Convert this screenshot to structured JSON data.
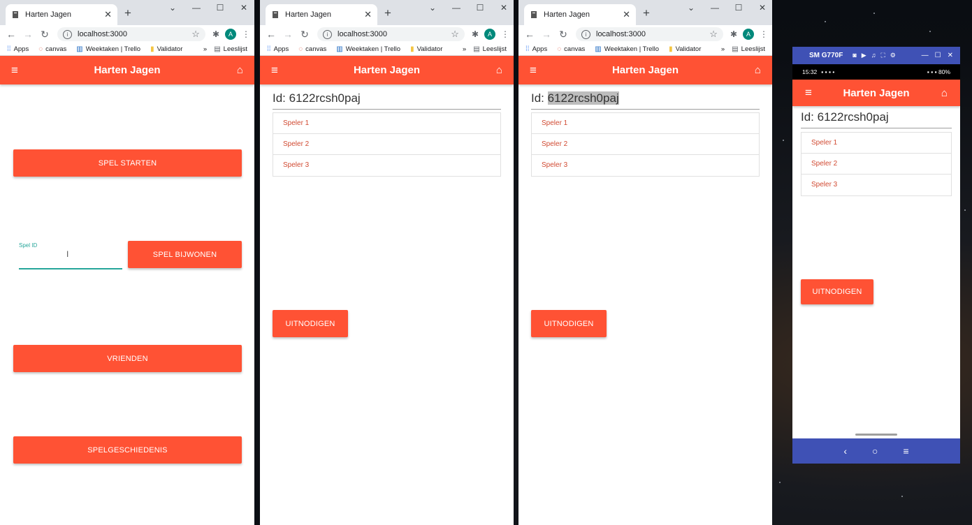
{
  "browser": {
    "tab_title": "Harten Jagen",
    "tab_close": "✕",
    "new_tab": "+",
    "url": "localhost:3000",
    "profile_initial": "A",
    "window_controls": {
      "dropdown": "⌄",
      "minimize": "—",
      "maximize": "☐",
      "close": "✕"
    },
    "bookmarks": [
      {
        "label": "Apps"
      },
      {
        "label": "canvas"
      },
      {
        "label": "Weektaken | Trello"
      },
      {
        "label": "Validator"
      }
    ],
    "bookmarks_more": "»",
    "reading_list": "Leeslijst"
  },
  "app": {
    "title": "Harten Jagen",
    "menu_icon": "≡",
    "home_icon": "⌂"
  },
  "home_page": {
    "start_button": "SPEL STARTEN",
    "spel_id_label": "Spel ID",
    "spel_id_value": "",
    "join_button": "SPEL BIJWONEN",
    "friends_button": "VRIENDEN",
    "history_button": "SPELGESCHIEDENIS"
  },
  "lobby": {
    "id_prefix": "Id: ",
    "id_value": "6122rcsh0paj",
    "players": [
      "Speler 1",
      "Speler 2",
      "Speler 3"
    ],
    "invite_button": "UITNODIGEN"
  },
  "phone": {
    "device_name": "SM G770F",
    "status_time": "15:32",
    "status_battery": "80%",
    "nav_back": "‹",
    "nav_home": "○",
    "nav_menu": "≡"
  },
  "colors": {
    "accent": "#ff5234",
    "input_focus": "#26a69a",
    "phone_frame": "#3f51b5",
    "player_text": "#d14a32"
  }
}
